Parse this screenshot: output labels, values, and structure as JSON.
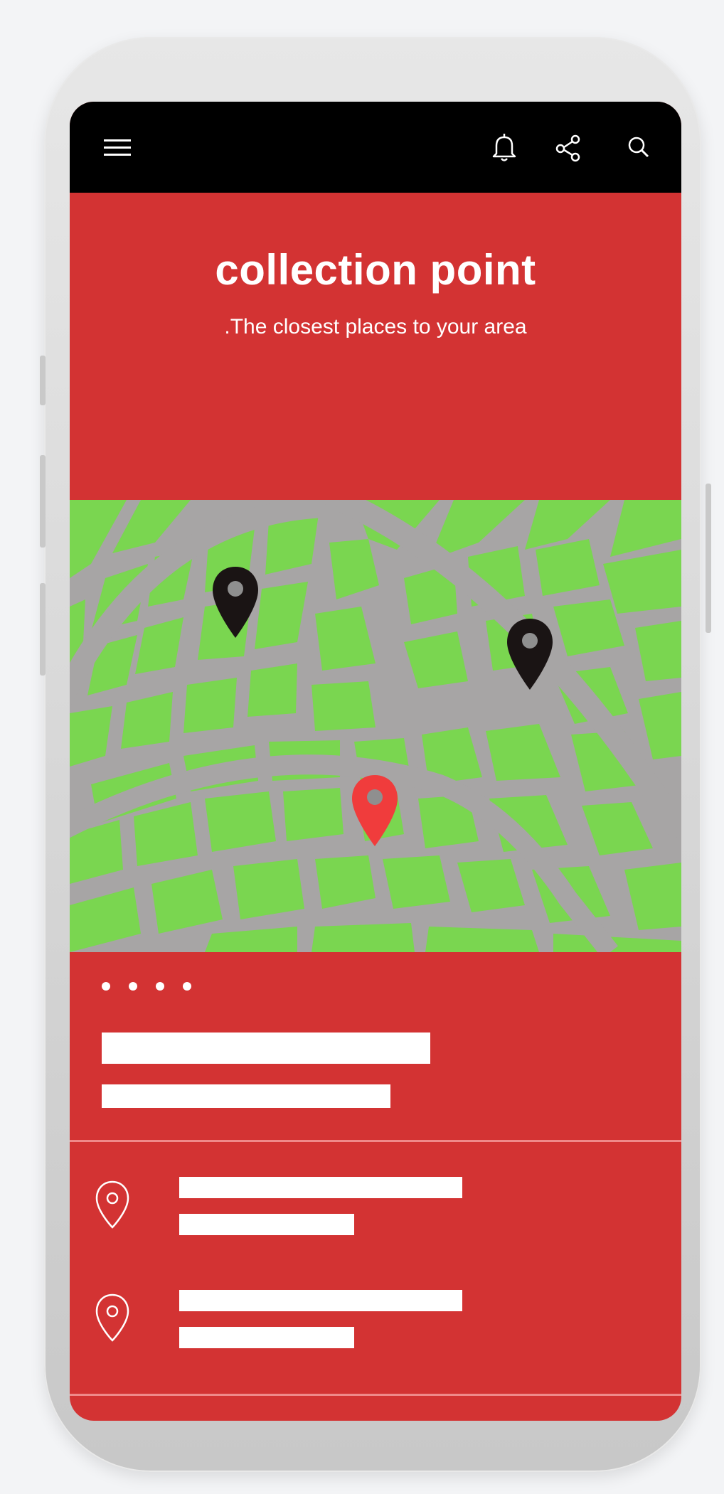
{
  "header": {
    "menu_icon": "hamburger-menu-icon",
    "notification_icon": "bell-icon",
    "share_icon": "share-icon",
    "search_icon": "search-icon"
  },
  "hero": {
    "title": "collection point",
    "subtitle": ".The closest places to your area"
  },
  "map": {
    "pins": [
      {
        "name": "location-marker",
        "color": "#1a1414"
      },
      {
        "name": "location-marker",
        "color": "#1a1414"
      },
      {
        "name": "selected-location-marker",
        "color": "#f03c3c"
      }
    ],
    "colors": {
      "blocks": "#7ad650",
      "roads": "#a7a5a5"
    }
  },
  "info": {
    "page_indicator_dots": 4
  },
  "locations": [
    {
      "icon": "location-pin-icon"
    },
    {
      "icon": "location-pin-icon"
    }
  ],
  "colors": {
    "brand_red": "#d33333",
    "topbar": "#000000",
    "text": "#ffffff"
  }
}
